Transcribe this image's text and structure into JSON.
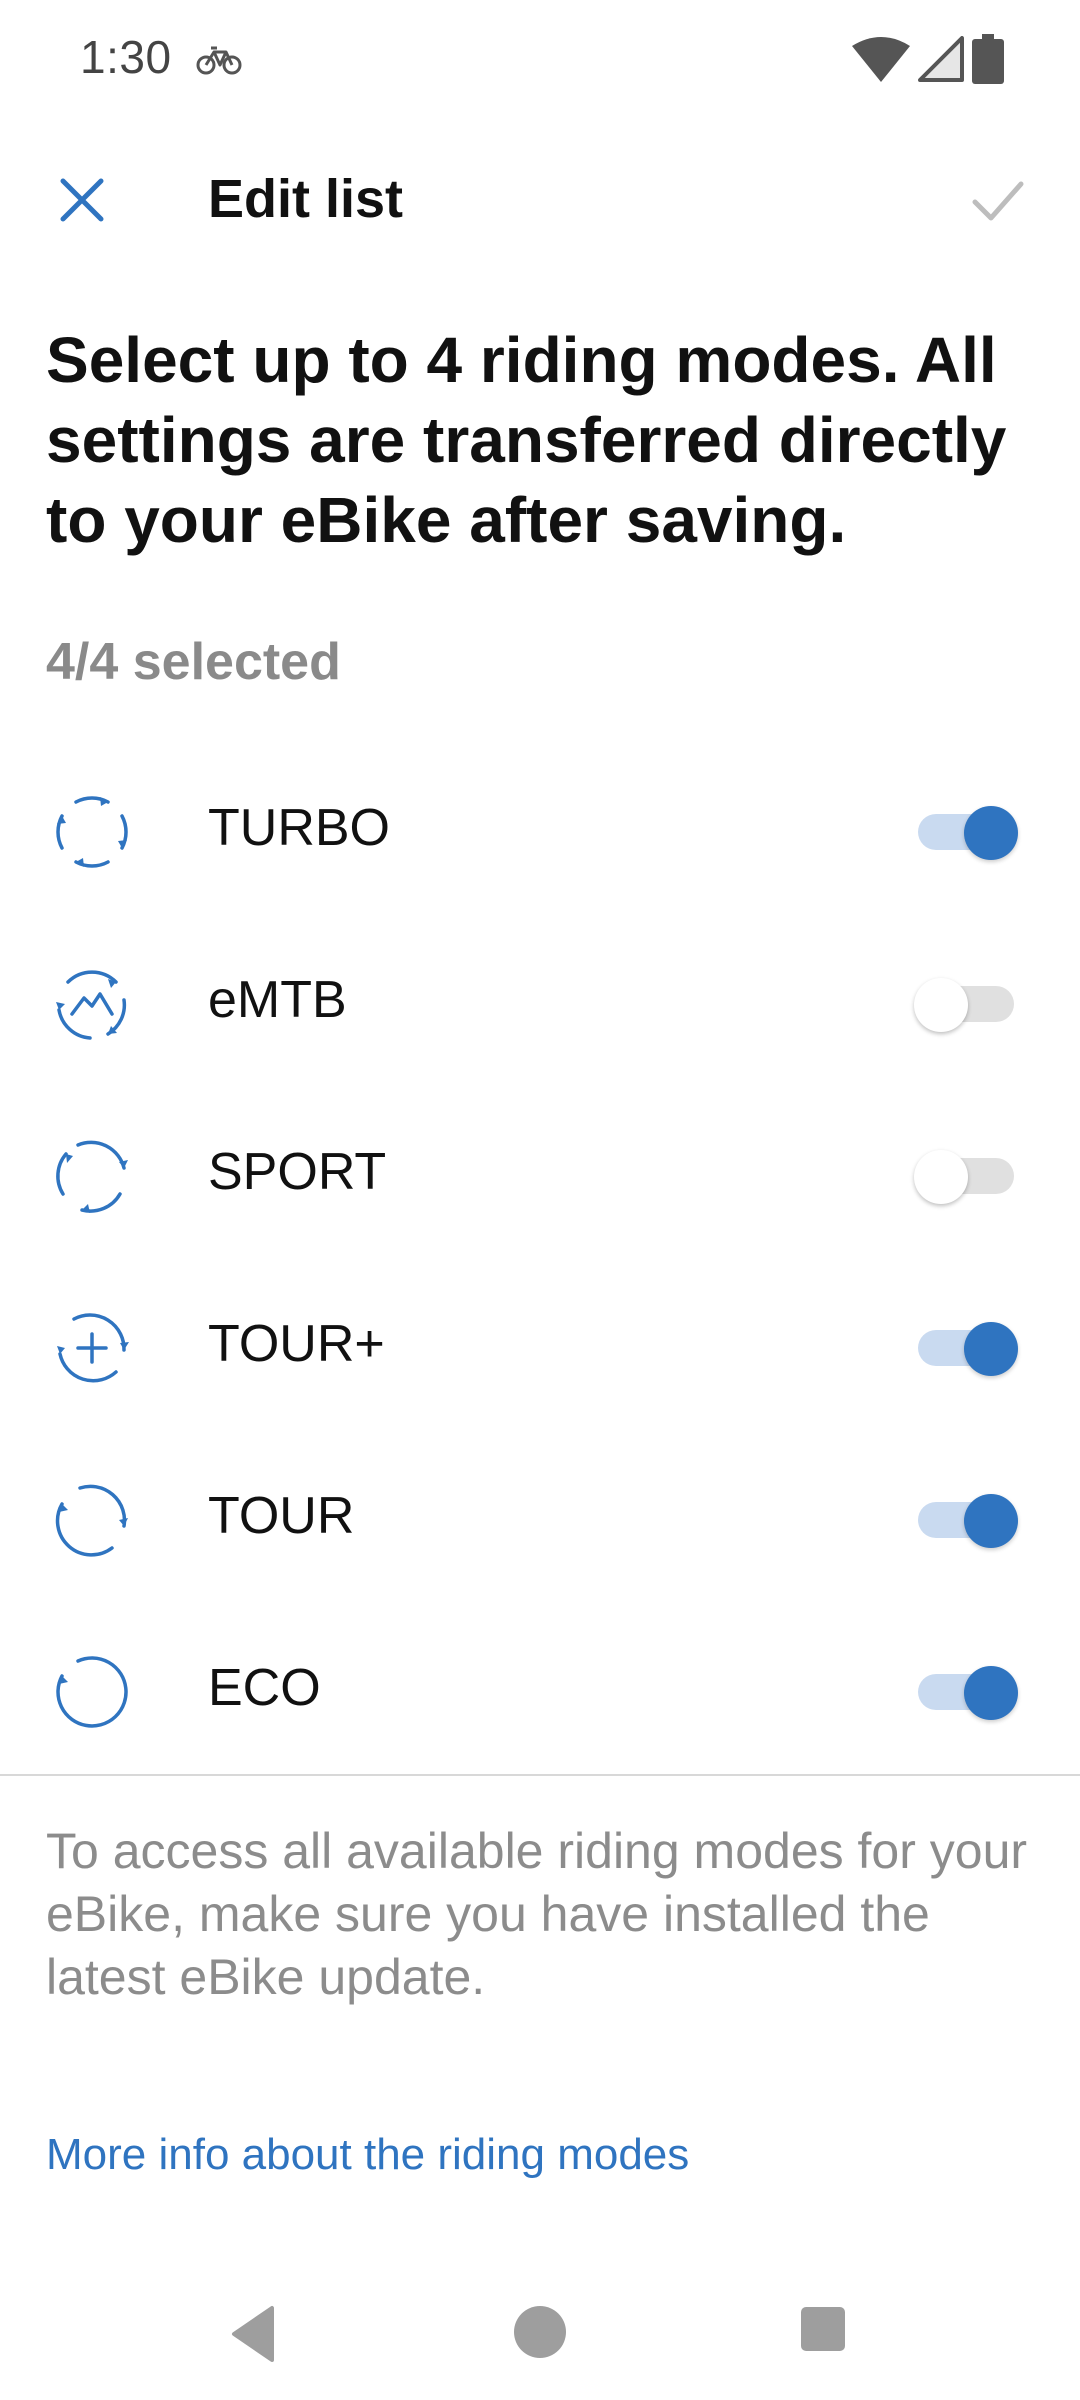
{
  "status_bar": {
    "time": "1:30",
    "icons": [
      "bicycle-icon",
      "wifi-icon",
      "signal-icon",
      "battery-icon"
    ]
  },
  "app_bar": {
    "title": "Edit list",
    "close_icon": "close-icon",
    "save_icon": "check-icon"
  },
  "headline": "Select up to 4 riding modes. All settings are transferred directly to your eBike after saving.",
  "selected_count": "4/4 selected",
  "modes": [
    {
      "label": "TURBO",
      "icon": "turbo-mode-icon",
      "enabled": true
    },
    {
      "label": "eMTB",
      "icon": "emtb-mode-icon",
      "enabled": false
    },
    {
      "label": "SPORT",
      "icon": "sport-mode-icon",
      "enabled": false
    },
    {
      "label": "TOUR+",
      "icon": "tour-plus-mode-icon",
      "enabled": true
    },
    {
      "label": "TOUR",
      "icon": "tour-mode-icon",
      "enabled": true
    },
    {
      "label": "ECO",
      "icon": "eco-mode-icon",
      "enabled": true
    }
  ],
  "info_text": "To access all available riding modes for your eBike, make sure you have installed the latest eBike update.",
  "more_link": "More info about the riding modes",
  "colors": {
    "accent": "#2f74c0",
    "accent_track": "#c9daf0",
    "muted_text": "#8a8a8a",
    "disabled_check": "#bdbdbd"
  },
  "nav_bar": [
    "back-icon",
    "home-icon",
    "recents-icon"
  ]
}
